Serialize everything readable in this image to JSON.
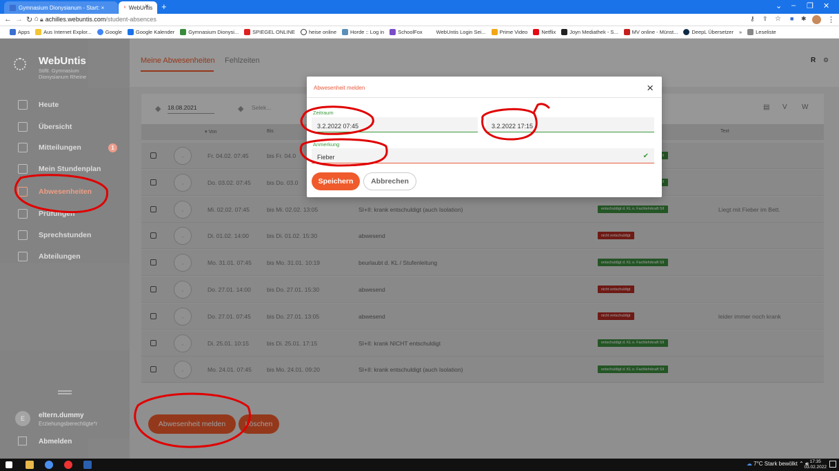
{
  "browser": {
    "tabs": [
      {
        "label": "Gymnasium Dionysianum - Start: ×",
        "active": false
      },
      {
        "label": "WebUntis",
        "active": true
      }
    ],
    "new_tab": "+",
    "url_host": "achilles.webuntis.com",
    "url_path": "/student-absences",
    "bookmarks": [
      "Apps",
      "Aus Internet Explor...",
      "Google",
      "Google Kalender",
      "Gymnasium Dionysi...",
      "SPIEGEL ONLINE",
      "heise online",
      "Horde :: Log in",
      "SchoolFox",
      "WebUntis Login Sei...",
      "Prime Video",
      "Netflix",
      "Joyn Mediathek - S...",
      "MV online - Münst...",
      "DeepL Übersetzer",
      "»",
      "Leseliste"
    ]
  },
  "app": {
    "logo": "WebUntis",
    "school_line1": "Stiftl. Gymnasium",
    "school_line2": "Dionysianum Rheine",
    "nav_tabs": [
      "Meine Abwesenheiten",
      "Fehlzeiten"
    ],
    "user_initial": "R",
    "sidebar": [
      {
        "label": "Heute"
      },
      {
        "label": "Übersicht"
      },
      {
        "label": "Mitteilungen",
        "badge": "1"
      },
      {
        "label": "Mein Stundenplan"
      },
      {
        "label": "Abwesenheiten"
      },
      {
        "label": "Prüfungen"
      },
      {
        "label": "Sprechstunden"
      },
      {
        "label": "Abteilungen"
      }
    ],
    "user_name": "eltern.dummy",
    "user_role": "Erziehungsberechtigte*r",
    "logout": "Abmelden",
    "filter_date": "18.08.2021",
    "filter_select": "Selek...",
    "table_headers": {
      "von": "▾ Von",
      "bis": "Bis",
      "text": "Text"
    },
    "rows": [
      {
        "von": "Fr. 04.02. 07:45",
        "bis": "bis Fr. 04.0",
        "reason": "",
        "status": "ok",
        "badge": "entschuldigt d. KL o. Fachlehrkraft SII",
        "text": ""
      },
      {
        "von": "Do. 03.02. 07:45",
        "bis": "bis Do. 03.0",
        "reason": "",
        "status": "ok",
        "badge": "entschuldigt d. KL o. Fachlehrkraft SII",
        "text": ""
      },
      {
        "von": "Mi. 02.02. 07:45",
        "bis": "bis Mi. 02.02. 13:05",
        "reason": "SI+II: krank entschuldigt (auch Isolation)",
        "status": "ok",
        "badge": "entschuldigt d. KL o. Fachlehrkraft SII",
        "text": "Liegt mit Fieber im Bett."
      },
      {
        "von": "Di. 01.02. 14:00",
        "bis": "bis Di. 01.02. 15:30",
        "reason": "abwesend",
        "status": "no",
        "badge": "nicht entschuldigt",
        "text": ""
      },
      {
        "von": "Mo. 31.01. 07:45",
        "bis": "bis Mo. 31.01. 10:19",
        "reason": "beurlaubt d. KL / Stufenleitung",
        "status": "ok",
        "badge": "entschuldigt d. KL o. Fachlehrkraft SII",
        "text": ""
      },
      {
        "von": "Do. 27.01. 14:00",
        "bis": "bis Do. 27.01. 15:30",
        "reason": "abwesend",
        "status": "no",
        "badge": "nicht entschuldigt",
        "text": ""
      },
      {
        "von": "Do. 27.01. 07:45",
        "bis": "bis Do. 27.01. 13:05",
        "reason": "abwesend",
        "status": "no",
        "badge": "nicht entschuldigt",
        "text": "leider immer noch krank"
      },
      {
        "von": "Di. 25.01. 10:15",
        "bis": "bis Di. 25.01. 17:15",
        "reason": "SI+II: krank NICHT entschuldigt",
        "status": "ok",
        "badge": "entschuldigt d. KL o. Fachlehrkraft SII",
        "text": ""
      },
      {
        "von": "Mo. 24.01. 07:45",
        "bis": "bis Mo. 24.01. 09:20",
        "reason": "SI+II: krank entschuldigt (auch Isolation)",
        "status": "ok",
        "badge": "entschuldigt d. KL o. Fachlehrkraft SII",
        "text": ""
      }
    ],
    "btn_report": "Abwesenheit melden",
    "btn_delete": "Löschen"
  },
  "modal": {
    "title": "Abwesenheit melden",
    "period_label": "Zeitraum",
    "from": "3.2.2022 07:45",
    "to": "3.2.2022 17:15",
    "remark_label": "Anmerkung",
    "remark": "Fieber",
    "save": "Speichern",
    "cancel": "Abbrechen"
  },
  "taskbar": {
    "weather": "7°C  Stark bewölkt",
    "time": "17:35",
    "date": "03.02.2022"
  },
  "colors": {
    "accent": "#ef5b2c",
    "ok": "#3a8a3d",
    "bad": "#b22b22",
    "annotation": "#e00000"
  }
}
